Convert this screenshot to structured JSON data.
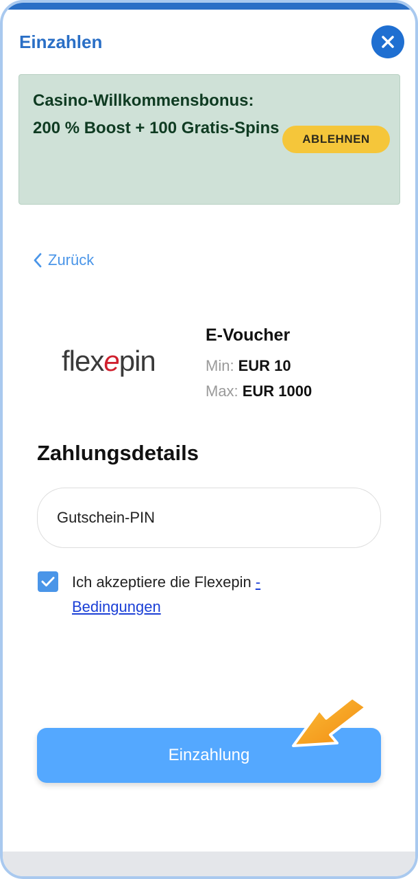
{
  "header": {
    "title": "Einzahlen",
    "close_icon": "close-icon"
  },
  "bonus": {
    "text": "Casino-Willkommensbonus: 200 % Boost + 100 Gratis-Spins",
    "decline_label": "ABLEHNEN",
    "bg_color": "#cfe1d7",
    "button_color": "#f5c63a"
  },
  "nav": {
    "back_label": "Zurück",
    "back_icon": "chevron-left-icon"
  },
  "payment_method": {
    "logo": {
      "part1": "flex",
      "part2": "e",
      "part3": "pin"
    },
    "title": "E-Voucher",
    "min_label": "Min:",
    "min_value": "EUR 10",
    "max_label": "Max:",
    "max_value": "EUR 1000"
  },
  "form": {
    "section_title": "Zahlungsdetails",
    "pin_placeholder": "Gutschein-PIN",
    "terms_text": "Ich akzeptiere die Flexepin ",
    "terms_link": "- Bedingungen",
    "checkbox_checked": true,
    "submit_label": "Einzahlung"
  },
  "colors": {
    "accent": "#2a6fc6",
    "submit": "#54a8ff",
    "arrow": "#f7a11a"
  }
}
